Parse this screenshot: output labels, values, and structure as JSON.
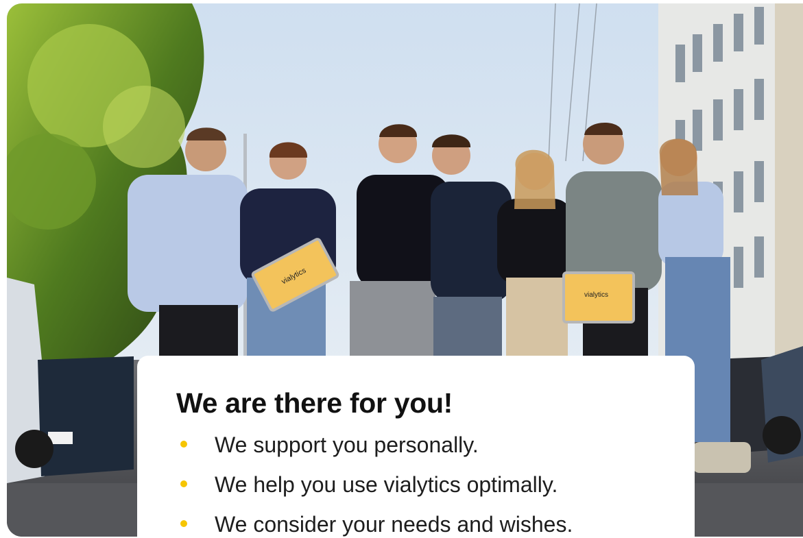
{
  "colors": {
    "accent": "#f6c500",
    "sky": "#dfe9f4",
    "text": "#111111"
  },
  "hero": {
    "image_description_icon": "team-photo-icon",
    "case_label": "vialytics"
  },
  "card": {
    "title": "We are there for you!",
    "bullets": [
      "We support you personally.",
      "We help you use vialytics optimally.",
      "We consider your needs and wishes."
    ]
  }
}
